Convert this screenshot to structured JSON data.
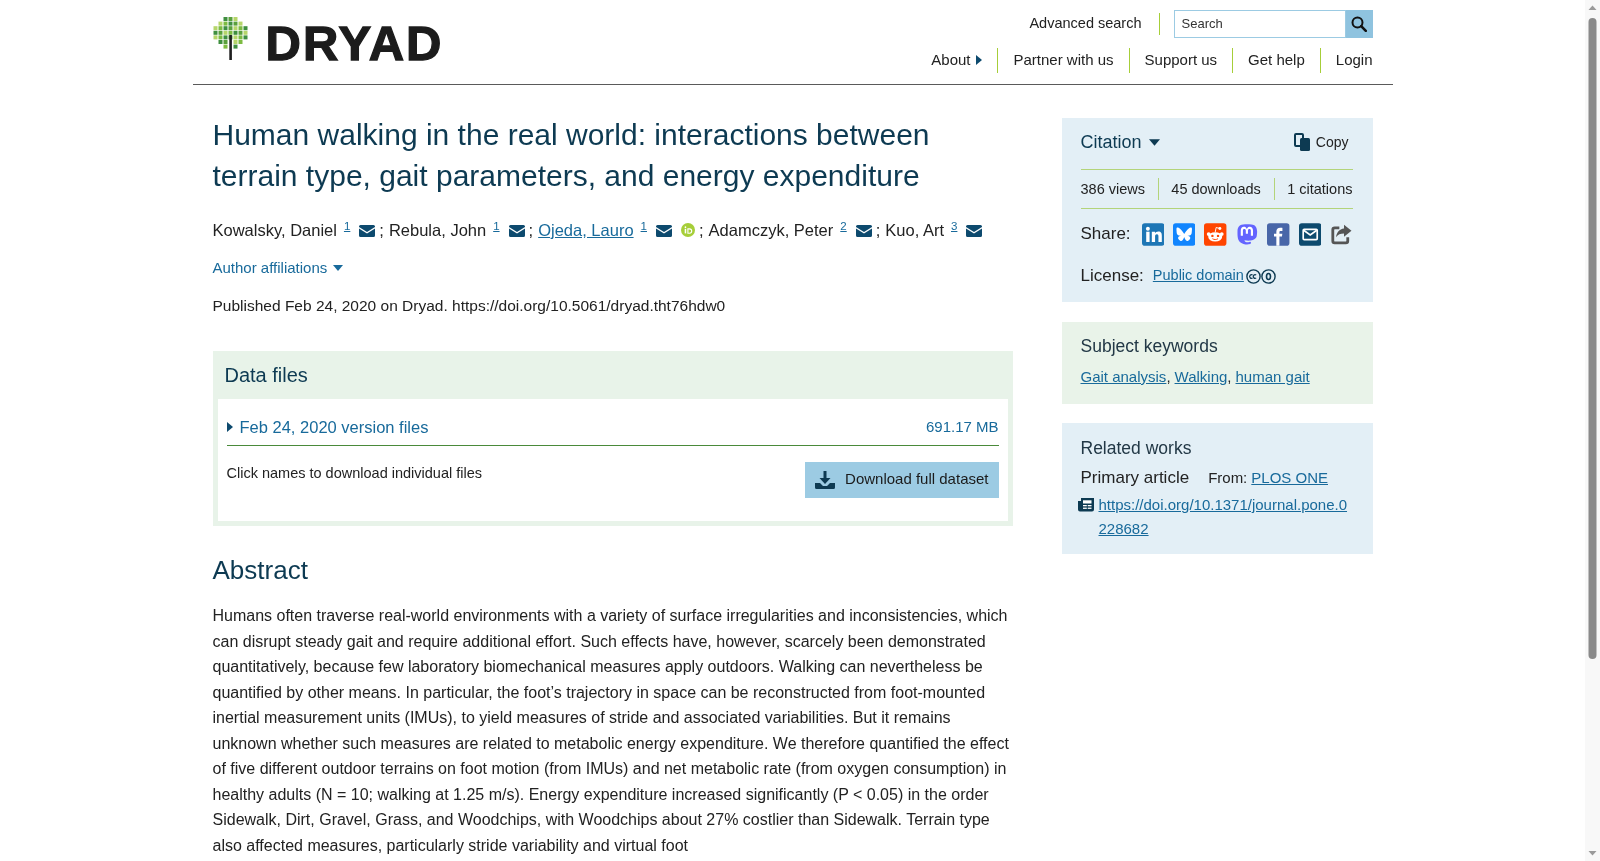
{
  "header": {
    "logo_text": "DRYAD",
    "advanced_search": "Advanced search",
    "search": {
      "placeholder": "Search"
    },
    "nav": [
      {
        "label": "About",
        "kind": "menu"
      },
      {
        "label": "Partner with us",
        "kind": "link"
      },
      {
        "label": "Support us",
        "kind": "link"
      },
      {
        "label": "Get help",
        "kind": "link"
      },
      {
        "label": "Login",
        "kind": "link"
      }
    ]
  },
  "dataset": {
    "title": "Human walking in the real world: interactions between terrain type, gait parameters, and energy expenditure",
    "authors": [
      {
        "name": "Kowalsky, Daniel",
        "affiliation": "1",
        "linked": false,
        "orcid": false,
        "separator": ";"
      },
      {
        "name": "Rebula, John",
        "affiliation": "1",
        "linked": false,
        "orcid": false,
        "separator": ";"
      },
      {
        "name": "Ojeda, Lauro",
        "affiliation": "1",
        "linked": true,
        "orcid": true,
        "separator": ";"
      },
      {
        "name": "Adamczyk, Peter",
        "affiliation": "2",
        "linked": false,
        "orcid": false,
        "separator": ";"
      },
      {
        "name": "Kuo, Art",
        "affiliation": "3",
        "linked": false,
        "orcid": false
      }
    ],
    "affiliations_toggle": "Author affiliations",
    "published": "Published Feb 24, 2020 on Dryad. https://doi.org/10.5061/dryad.tht76hdw0"
  },
  "data_files": {
    "title": "Data files",
    "versions": [
      {
        "label": "Feb 24, 2020 version files",
        "size": "691.17 MB",
        "expanded": false
      }
    ],
    "hint": "Click names to download individual files",
    "download_button": "Download full dataset"
  },
  "abstract": {
    "title": "Abstract",
    "text": "Humans often traverse real-world environments with a variety of surface irregularities and inconsistencies, which can disrupt steady gait and require additional effort. Such effects have, however, scarcely been demonstrated quantitatively, because few laboratory biomechanical measures apply outdoors. Walking can nevertheless be quantified by other means. In particular, the foot’s trajectory in space can be reconstructed from foot-mounted inertial measurement units (IMUs), to yield measures of stride and associated variabilities. But it remains unknown whether such measures are related to metabolic energy expenditure. We therefore quantified the effect of five different outdoor terrains on foot motion (from IMUs) and net metabolic rate (from oxygen consumption) in healthy adults (N = 10; walking at 1.25 m/s). Energy expenditure increased significantly (P < 0.05) in the order Sidewalk, Dirt, Gravel, Grass, and Woodchips, with Woodchips about 27% costlier than Sidewalk. Terrain type also affected measures, particularly stride variability and virtual foot"
  },
  "sidebar": {
    "citation": {
      "title": "Citation",
      "copy_button": "Copy"
    },
    "metrics": [
      "386 views",
      "45 downloads",
      "1 citations"
    ],
    "share_label": "Share:",
    "license": {
      "label": "License:",
      "value": "Public domain"
    },
    "keywords": {
      "title": "Subject keywords",
      "items": [
        {
          "label": "Gait analysis",
          "separator": ","
        },
        {
          "label": "Walking",
          "separator": ","
        },
        {
          "label": "human gait"
        }
      ]
    },
    "related_works": {
      "title": "Related works",
      "items": [
        {
          "type": "Primary article",
          "from_label": "From:",
          "source": "PLOS ONE",
          "url": "https://doi.org/10.1371/journal.pone.0228682"
        }
      ]
    }
  }
}
